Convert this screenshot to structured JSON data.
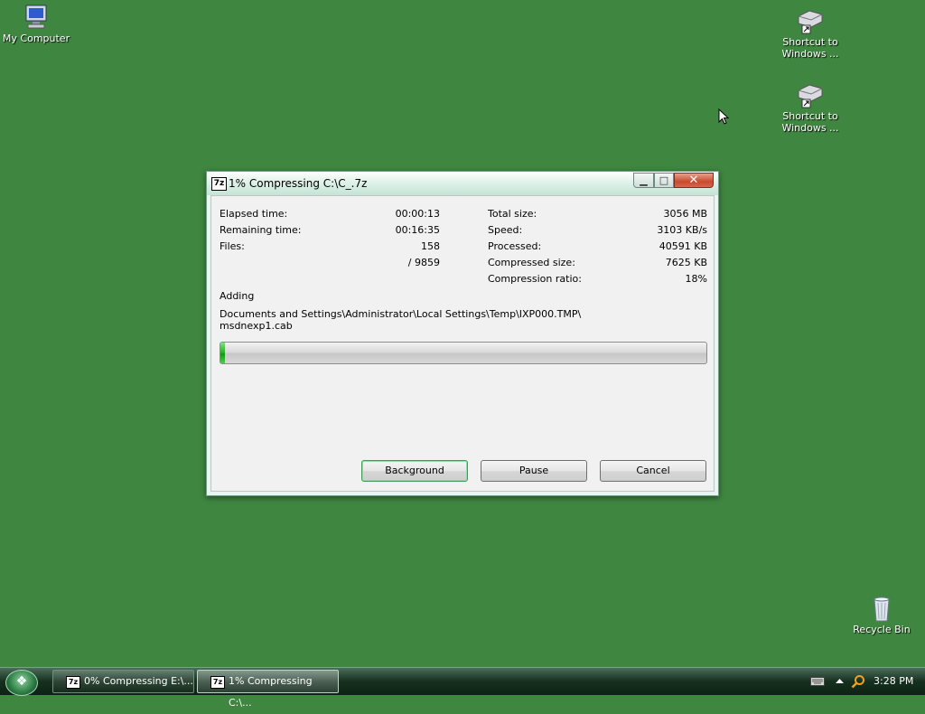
{
  "desktop": {
    "icons": [
      {
        "label": "My Computer"
      },
      {
        "label_line1": "Shortcut to",
        "label_line2": "Windows ..."
      },
      {
        "label_line1": "Shortcut to",
        "label_line2": "Windows ..."
      },
      {
        "label": "Recycle Bin"
      }
    ]
  },
  "window": {
    "icon_text": "7z",
    "title": "1% Compressing C:\\C_.7z",
    "left_stats": [
      {
        "label": "Elapsed time:",
        "value": "00:00:13"
      },
      {
        "label": "Remaining time:",
        "value": "00:16:35"
      },
      {
        "label": "Files:",
        "value": "158"
      },
      {
        "label": "",
        "value": "/ 9859"
      }
    ],
    "right_stats": [
      {
        "label": "Total size:",
        "value": "3056 MB"
      },
      {
        "label": "Speed:",
        "value": "3103 KB/s"
      },
      {
        "label": "Processed:",
        "value": "40591 KB"
      },
      {
        "label": "Compressed size:",
        "value": "7625 KB"
      },
      {
        "label": "Compression ratio:",
        "value": "18%"
      }
    ],
    "action": "Adding",
    "path_line1": "Documents and Settings\\Administrator\\Local Settings\\Temp\\IXP000.TMP\\",
    "path_line2": "msdnexp1.cab",
    "progress_percent": 1,
    "buttons": {
      "background": "Background",
      "pause": "Pause",
      "cancel": "Cancel"
    }
  },
  "taskbar": {
    "tasks": [
      {
        "icon_text": "7z",
        "label": "0% Compressing E:\\..."
      },
      {
        "icon_text": "7z",
        "label": "1% Compressing C:\\..."
      }
    ],
    "clock": "3:28 PM"
  },
  "colors": {
    "desktop": "#3f8640",
    "progress": "#22b022",
    "accent": "#3c9a5a"
  }
}
